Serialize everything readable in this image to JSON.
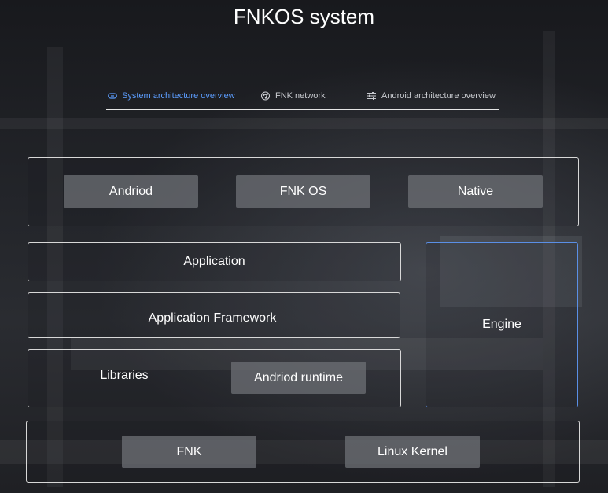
{
  "title": "FNKOS system",
  "tabs": [
    {
      "label": "System architecture overview",
      "icon": "link-icon",
      "active": true
    },
    {
      "label": "FNK network",
      "icon": "network-icon",
      "active": false
    },
    {
      "label": "Android architecture overview",
      "icon": "sliders-icon",
      "active": false
    }
  ],
  "colors": {
    "accent": "#5c9dff",
    "engine_border": "#5a8fe6",
    "chip_bg": "#6e7076"
  },
  "top_layer": {
    "items": [
      "Andriod",
      "FNK OS",
      "Native"
    ]
  },
  "stack": {
    "application": "Application",
    "framework": "Application Framework",
    "libraries": "Libraries",
    "runtime": "Andriod runtime"
  },
  "engine": "Engine",
  "bottom_layer": {
    "items": [
      "FNK",
      "Linux Kernel"
    ]
  }
}
